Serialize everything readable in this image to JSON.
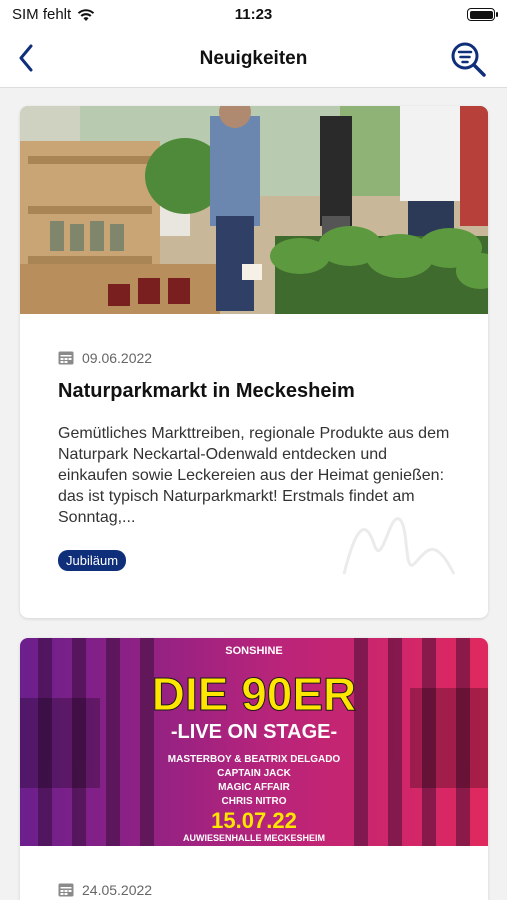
{
  "status": {
    "carrier": "SIM fehlt",
    "time": "11:23"
  },
  "nav": {
    "title": "Neuigkeiten",
    "back_icon": "chevron-left-icon",
    "filter_icon": "search-filter-icon"
  },
  "colors": {
    "accent": "#0f2f7a",
    "tag_bg": "#0f2f7a"
  },
  "articles": [
    {
      "date": "09.06.2022",
      "title": "Naturparkmarkt in Meckesheim",
      "excerpt": "Gemütliches Markttreiben, regionale Produkte aus dem Naturpark Neckartal-Odenwald entdecken und einkaufen sowie Leckereien aus der Heimat genießen: das ist typisch Naturparkmarkt! Erstmals findet am Sonntag,...",
      "tag": "Jubiläum"
    },
    {
      "date": "24.05.2022",
      "poster": {
        "brand": "SONSHINE",
        "headline": "DIE 90ER",
        "subhead": "-LIVE ON STAGE-",
        "acts": [
          "MASTERBOY & BEATRIX DELGADO",
          "CAPTAIN JACK",
          "MAGIC AFFAIR",
          "CHRIS NITRO"
        ],
        "date": "15.07.22",
        "venue": "AUWIESENHALLE MECKESHEIM"
      }
    }
  ]
}
